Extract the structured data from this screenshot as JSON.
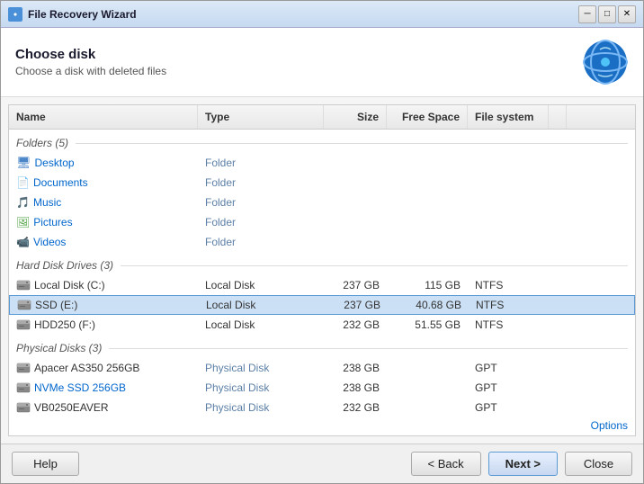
{
  "window": {
    "title": "File Recovery Wizard",
    "minimize_label": "─",
    "maximize_label": "□",
    "close_label": "✕"
  },
  "header": {
    "title": "Choose disk",
    "subtitle": "Choose a disk with deleted files"
  },
  "table": {
    "columns": [
      "Name",
      "Type",
      "Size",
      "Free Space",
      "File system"
    ],
    "sections": [
      {
        "label": "Folders (5)",
        "rows": [
          {
            "name": "Desktop",
            "type": "Folder",
            "size": "",
            "free_space": "",
            "fs": "",
            "icon": "desktop"
          },
          {
            "name": "Documents",
            "type": "Folder",
            "size": "",
            "free_space": "",
            "fs": "",
            "icon": "documents"
          },
          {
            "name": "Music",
            "type": "Folder",
            "size": "",
            "free_space": "",
            "fs": "",
            "icon": "music"
          },
          {
            "name": "Pictures",
            "type": "Folder",
            "size": "",
            "free_space": "",
            "fs": "",
            "icon": "pictures"
          },
          {
            "name": "Videos",
            "type": "Folder",
            "size": "",
            "free_space": "",
            "fs": "",
            "icon": "videos"
          }
        ]
      },
      {
        "label": "Hard Disk Drives (3)",
        "rows": [
          {
            "name": "Local Disk (C:)",
            "type": "Local Disk",
            "size": "237 GB",
            "free_space": "115 GB",
            "fs": "NTFS",
            "icon": "disk",
            "selected": false
          },
          {
            "name": "SSD (E:)",
            "type": "Local Disk",
            "size": "237 GB",
            "free_space": "40.68 GB",
            "fs": "NTFS",
            "icon": "disk",
            "selected": true
          },
          {
            "name": "HDD250 (F:)",
            "type": "Local Disk",
            "size": "232 GB",
            "free_space": "51.55 GB",
            "fs": "NTFS",
            "icon": "disk",
            "selected": false
          }
        ]
      },
      {
        "label": "Physical Disks (3)",
        "rows": [
          {
            "name": "Apacer AS350 256GB",
            "type": "Physical Disk",
            "size": "238 GB",
            "free_space": "",
            "fs": "GPT",
            "icon": "disk",
            "selected": false
          },
          {
            "name": "NVMe SSD 256GB",
            "type": "Physical Disk",
            "size": "238 GB",
            "free_space": "",
            "fs": "GPT",
            "icon": "disk",
            "selected": false
          },
          {
            "name": "VB0250EAVER",
            "type": "Physical Disk",
            "size": "232 GB",
            "free_space": "",
            "fs": "GPT",
            "icon": "disk",
            "selected": false
          }
        ]
      }
    ]
  },
  "footer": {
    "options_label": "Options"
  },
  "buttons": {
    "help_label": "Help",
    "back_label": "< Back",
    "next_label": "Next >",
    "close_label": "Close"
  },
  "icons": {
    "desktop": "🖥",
    "documents": "📄",
    "music": "🎵",
    "pictures": "🖼",
    "videos": "📹",
    "disk": "💾"
  }
}
